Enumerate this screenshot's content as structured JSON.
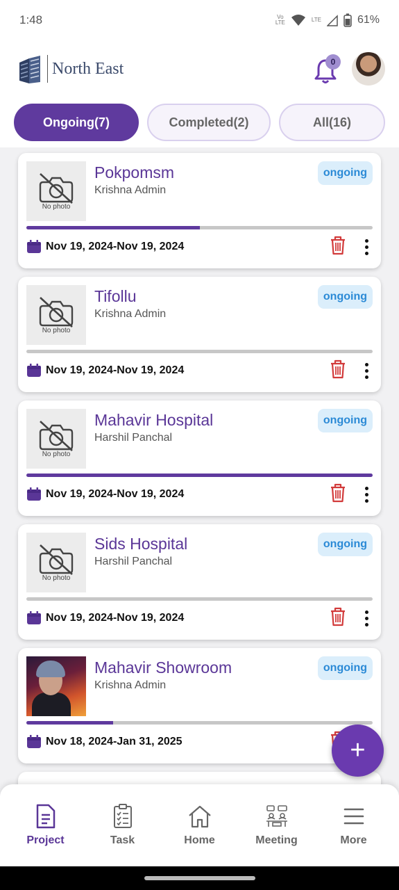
{
  "status_bar": {
    "time": "1:48",
    "battery": "61%",
    "net1": "Vo\nLTE",
    "net2": "LTE"
  },
  "header": {
    "brand": "North East",
    "notification_count": "0"
  },
  "tabs": [
    {
      "label": "Ongoing(7)",
      "active": true
    },
    {
      "label": "Completed(2)",
      "active": false
    },
    {
      "label": "All(16)",
      "active": false
    }
  ],
  "projects": [
    {
      "title": "Pokpomsm",
      "owner": "Krishna Admin",
      "status": "ongoing",
      "dates": "Nov 19, 2024-Nov 19, 2024",
      "progress": 0.5,
      "photo": false
    },
    {
      "title": "Tifollu",
      "owner": "Krishna Admin",
      "status": "ongoing",
      "dates": "Nov 19, 2024-Nov 19, 2024",
      "progress": 0,
      "photo": false
    },
    {
      "title": "Mahavir Hospital",
      "owner": "Harshil Panchal",
      "status": "ongoing",
      "dates": "Nov 19, 2024-Nov 19, 2024",
      "progress": 1.0,
      "photo": false
    },
    {
      "title": "Sids Hospital",
      "owner": "Harshil Panchal",
      "status": "ongoing",
      "dates": "Nov 19, 2024-Nov 19, 2024",
      "progress": 0,
      "photo": false
    },
    {
      "title": "Mahavir Showroom",
      "owner": "Krishna Admin",
      "status": "ongoing",
      "dates": "Nov 18, 2024-Jan 31, 2025",
      "progress": 0.25,
      "photo": true
    }
  ],
  "no_photo_text": "No photo",
  "fab_label": "+",
  "bottom_nav": [
    {
      "label": "Project",
      "icon": "document-icon",
      "active": true
    },
    {
      "label": "Task",
      "icon": "checklist-icon",
      "active": false
    },
    {
      "label": "Home",
      "icon": "home-icon",
      "active": false
    },
    {
      "label": "Meeting",
      "icon": "meeting-icon",
      "active": false
    },
    {
      "label": "More",
      "icon": "menu-icon",
      "active": false
    }
  ],
  "colors": {
    "primary": "#5f3a9e",
    "badge_bg": "#dbeefb",
    "badge_text": "#2b8ad6",
    "trash": "#d23b3b"
  }
}
